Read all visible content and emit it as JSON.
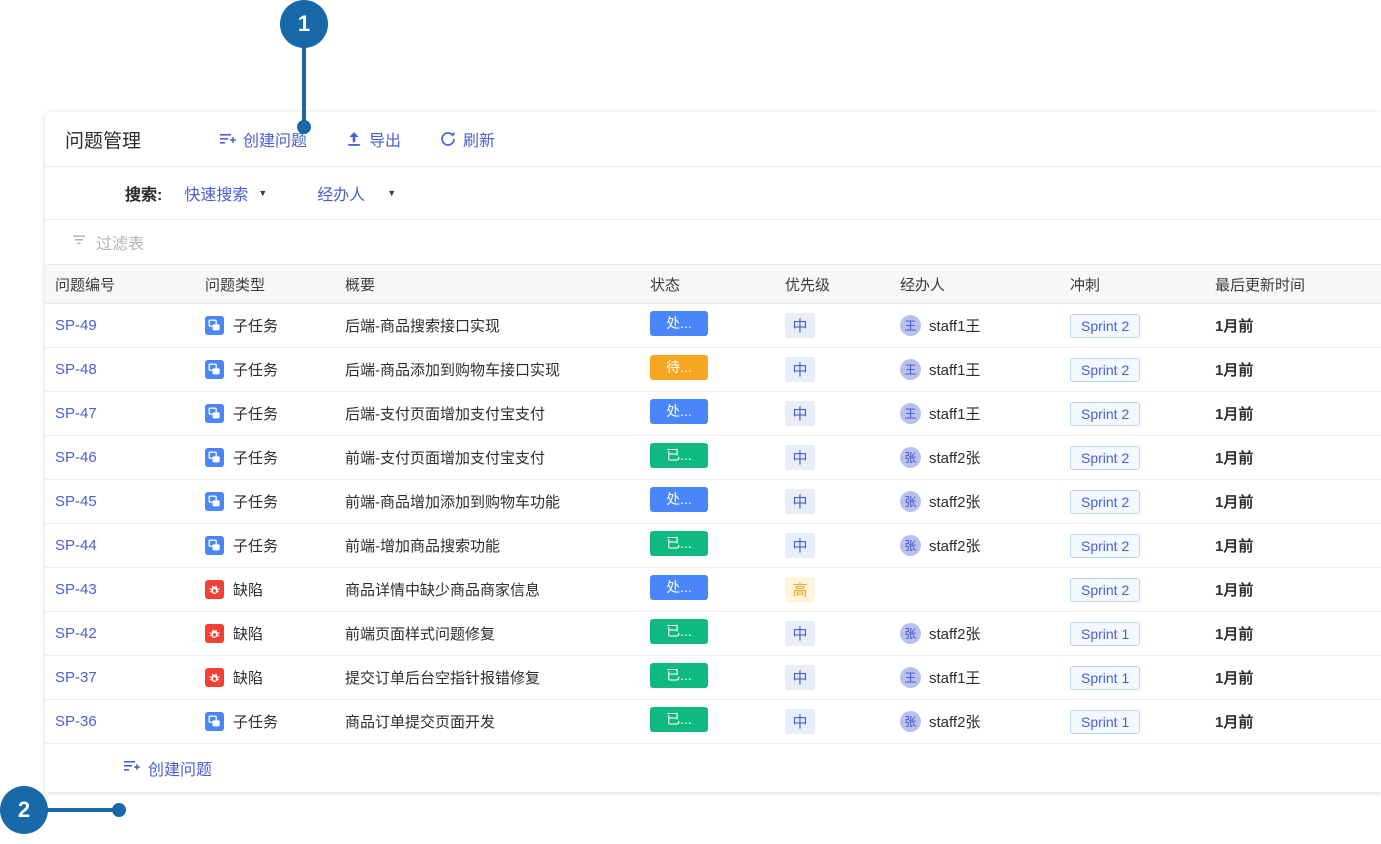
{
  "callouts": [
    {
      "number": "1",
      "target": "create-issue-toolbar-button"
    },
    {
      "number": "2",
      "target": "create-issue-footer-button"
    }
  ],
  "toolbar": {
    "title": "问题管理",
    "buttons": [
      {
        "label": "创建问题",
        "icon": "list-plus-icon"
      },
      {
        "label": "导出",
        "icon": "upload-icon"
      },
      {
        "label": "刷新",
        "icon": "refresh-icon"
      }
    ]
  },
  "search": {
    "label": "搜索:",
    "dropdowns": [
      {
        "label": "快速搜索",
        "icon": "chevron-down-icon"
      },
      {
        "label": "经办人",
        "icon": "chevron-down-icon"
      }
    ]
  },
  "filter": {
    "placeholder": "过滤表",
    "icon": "filter-icon"
  },
  "table": {
    "columns": [
      "问题编号",
      "问题类型",
      "概要",
      "状态",
      "优先级",
      "经办人",
      "冲刺",
      "最后更新时间"
    ],
    "rows": [
      {
        "key": "SP-49",
        "type": "子任务",
        "type_icon": "subtask",
        "summary": "后端-商品搜索接口实现",
        "status": "处...",
        "status_kind": "inprogress",
        "priority": "中",
        "priority_kind": "medium",
        "assignee": "staff1王",
        "assignee_initial": "王",
        "sprint": "Sprint 2",
        "updated": "1月前"
      },
      {
        "key": "SP-48",
        "type": "子任务",
        "type_icon": "subtask",
        "summary": "后端-商品添加到购物车接口实现",
        "status": "待...",
        "status_kind": "todo",
        "priority": "中",
        "priority_kind": "medium",
        "assignee": "staff1王",
        "assignee_initial": "王",
        "sprint": "Sprint 2",
        "updated": "1月前"
      },
      {
        "key": "SP-47",
        "type": "子任务",
        "type_icon": "subtask",
        "summary": "后端-支付页面增加支付宝支付",
        "status": "处...",
        "status_kind": "inprogress",
        "priority": "中",
        "priority_kind": "medium",
        "assignee": "staff1王",
        "assignee_initial": "王",
        "sprint": "Sprint 2",
        "updated": "1月前"
      },
      {
        "key": "SP-46",
        "type": "子任务",
        "type_icon": "subtask",
        "summary": "前端-支付页面增加支付宝支付",
        "status": "已...",
        "status_kind": "done",
        "priority": "中",
        "priority_kind": "medium",
        "assignee": "staff2张",
        "assignee_initial": "张",
        "sprint": "Sprint 2",
        "updated": "1月前"
      },
      {
        "key": "SP-45",
        "type": "子任务",
        "type_icon": "subtask",
        "summary": "前端-商品增加添加到购物车功能",
        "status": "处...",
        "status_kind": "inprogress",
        "priority": "中",
        "priority_kind": "medium",
        "assignee": "staff2张",
        "assignee_initial": "张",
        "sprint": "Sprint 2",
        "updated": "1月前"
      },
      {
        "key": "SP-44",
        "type": "子任务",
        "type_icon": "subtask",
        "summary": "前端-增加商品搜索功能",
        "status": "已...",
        "status_kind": "done",
        "priority": "中",
        "priority_kind": "medium",
        "assignee": "staff2张",
        "assignee_initial": "张",
        "sprint": "Sprint 2",
        "updated": "1月前"
      },
      {
        "key": "SP-43",
        "type": "缺陷",
        "type_icon": "bug",
        "summary": "商品详情中缺少商品商家信息",
        "status": "处...",
        "status_kind": "inprogress",
        "priority": "高",
        "priority_kind": "high",
        "assignee": "",
        "assignee_initial": "",
        "sprint": "Sprint 2",
        "updated": "1月前"
      },
      {
        "key": "SP-42",
        "type": "缺陷",
        "type_icon": "bug",
        "summary": "前端页面样式问题修复",
        "status": "已...",
        "status_kind": "done",
        "priority": "中",
        "priority_kind": "medium",
        "assignee": "staff2张",
        "assignee_initial": "张",
        "sprint": "Sprint 1",
        "updated": "1月前"
      },
      {
        "key": "SP-37",
        "type": "缺陷",
        "type_icon": "bug",
        "summary": "提交订单后台空指针报错修复",
        "status": "已...",
        "status_kind": "done",
        "priority": "中",
        "priority_kind": "medium",
        "assignee": "staff1王",
        "assignee_initial": "王",
        "sprint": "Sprint 1",
        "updated": "1月前"
      },
      {
        "key": "SP-36",
        "type": "子任务",
        "type_icon": "subtask",
        "summary": "商品订单提交页面开发",
        "status": "已...",
        "status_kind": "done",
        "priority": "中",
        "priority_kind": "medium",
        "assignee": "staff2张",
        "assignee_initial": "张",
        "sprint": "Sprint 1",
        "updated": "1月前"
      }
    ]
  },
  "footer": {
    "create_label": "创建问题",
    "icon": "list-plus-icon"
  },
  "colors": {
    "link": "#4a5fd4",
    "callout": "#1769aa",
    "status_inprogress": "#4a86f7",
    "status_todo": "#f5a623",
    "status_done": "#10b981",
    "type_subtask": "#4a86f7",
    "type_bug": "#f04134",
    "avatar_bg": "#b9c0ef"
  }
}
